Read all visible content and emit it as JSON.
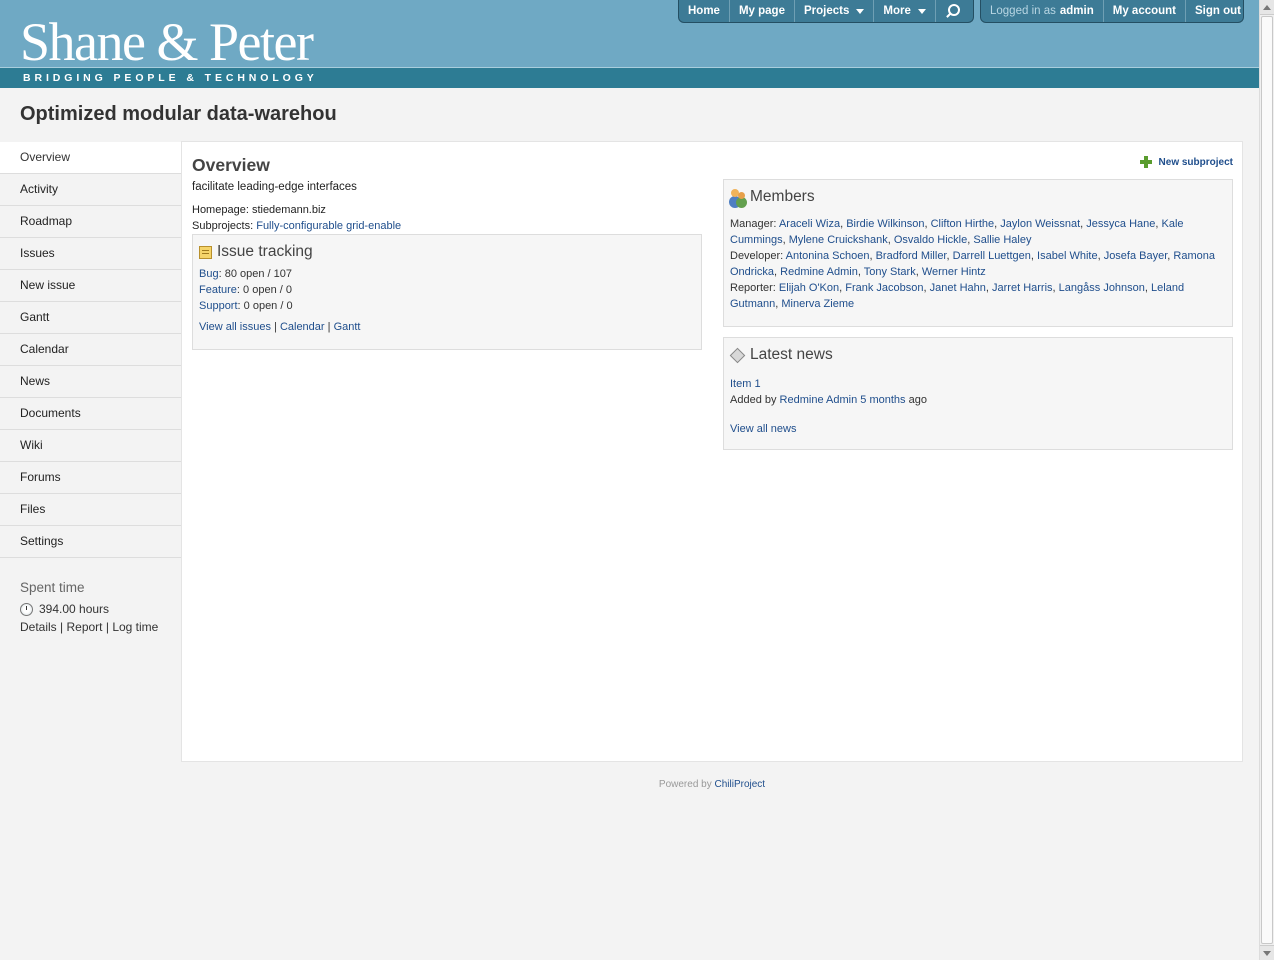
{
  "header": {
    "brand": "Shane & Peter",
    "tagline": "BRIDGING PEOPLE & TECHNOLOGY",
    "nav": {
      "home": "Home",
      "my_page": "My page",
      "projects": "Projects",
      "more": "More"
    },
    "user": {
      "logged_label": "Logged in as",
      "username": "admin",
      "my_account": "My account",
      "sign_out": "Sign out"
    }
  },
  "project": {
    "title": "Optimized modular data-warehou"
  },
  "sidebar": {
    "items": [
      {
        "label": "Overview"
      },
      {
        "label": "Activity"
      },
      {
        "label": "Roadmap"
      },
      {
        "label": "Issues"
      },
      {
        "label": "New issue"
      },
      {
        "label": "Gantt"
      },
      {
        "label": "Calendar"
      },
      {
        "label": "News"
      },
      {
        "label": "Documents"
      },
      {
        "label": "Wiki"
      },
      {
        "label": "Forums"
      },
      {
        "label": "Files"
      },
      {
        "label": "Settings"
      }
    ],
    "spent_time": {
      "title": "Spent time",
      "hours": "394.00 hours",
      "details": "Details",
      "report": "Report",
      "log_time": "Log time"
    }
  },
  "overview": {
    "title": "Overview",
    "new_subproject": "New subproject",
    "description": "facilitate leading-edge interfaces",
    "homepage_label": "Homepage:",
    "homepage_value": "stiedemann.biz",
    "subprojects_label": "Subprojects:",
    "subprojects_value": "Fully-configurable grid-enable"
  },
  "issue_tracking": {
    "title": "Issue tracking",
    "trackers": [
      {
        "name": "Bug",
        "counts": "80 open / 107"
      },
      {
        "name": "Feature",
        "counts": "0 open / 0"
      },
      {
        "name": "Support",
        "counts": "0 open / 0"
      }
    ],
    "view_all": "View all issues",
    "calendar": "Calendar",
    "gantt": "Gantt"
  },
  "members": {
    "title": "Members",
    "roles": [
      {
        "role": "Manager:",
        "people": [
          "Araceli Wiza",
          "Birdie Wilkinson",
          "Clifton Hirthe",
          "Jaylon Weissnat",
          "Jessyca Hane",
          "Kale Cummings",
          "Mylene Cruickshank",
          "Osvaldo Hickle",
          "Sallie Haley"
        ]
      },
      {
        "role": "Developer:",
        "people": [
          "Antonina Schoen",
          "Bradford Miller",
          "Darrell Luettgen",
          "Isabel White",
          "Josefa Bayer",
          "Ramona Ondricka",
          "Redmine Admin",
          "Tony Stark",
          "Werner Hintz"
        ]
      },
      {
        "role": "Reporter:",
        "people": [
          "Elijah O'Kon",
          "Frank Jacobson",
          "Janet Hahn",
          "Jarret Harris",
          "Langåss Johnson",
          "Leland Gutmann",
          "Minerva Zieme"
        ]
      }
    ]
  },
  "news": {
    "title": "Latest news",
    "item": "Item 1",
    "added_by": "Added by",
    "author": "Redmine Admin",
    "time": "5 months",
    "ago": "ago",
    "view_all": "View all news"
  },
  "footer": {
    "powered_by": "Powered by",
    "product": "ChiliProject"
  }
}
